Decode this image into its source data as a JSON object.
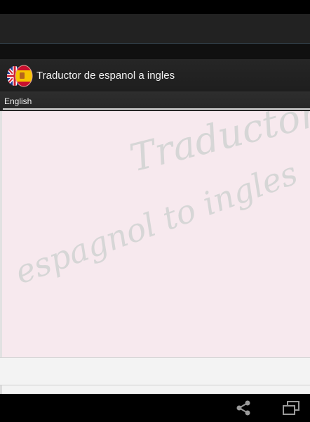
{
  "app": {
    "title": "Traductor de espanol a ingles"
  },
  "language_selector": {
    "selected": "English"
  },
  "watermark": {
    "line1": "Traductor",
    "line2": "espagnol to ingles"
  },
  "icons": {
    "app": "uk-spain-flag-icon",
    "share": "share-icon",
    "recent_apps": "recent-apps-icon"
  },
  "colors": {
    "content_background": "#f7e9ee",
    "watermark_text": "#d6d6d6",
    "action_bar": "#222222"
  }
}
